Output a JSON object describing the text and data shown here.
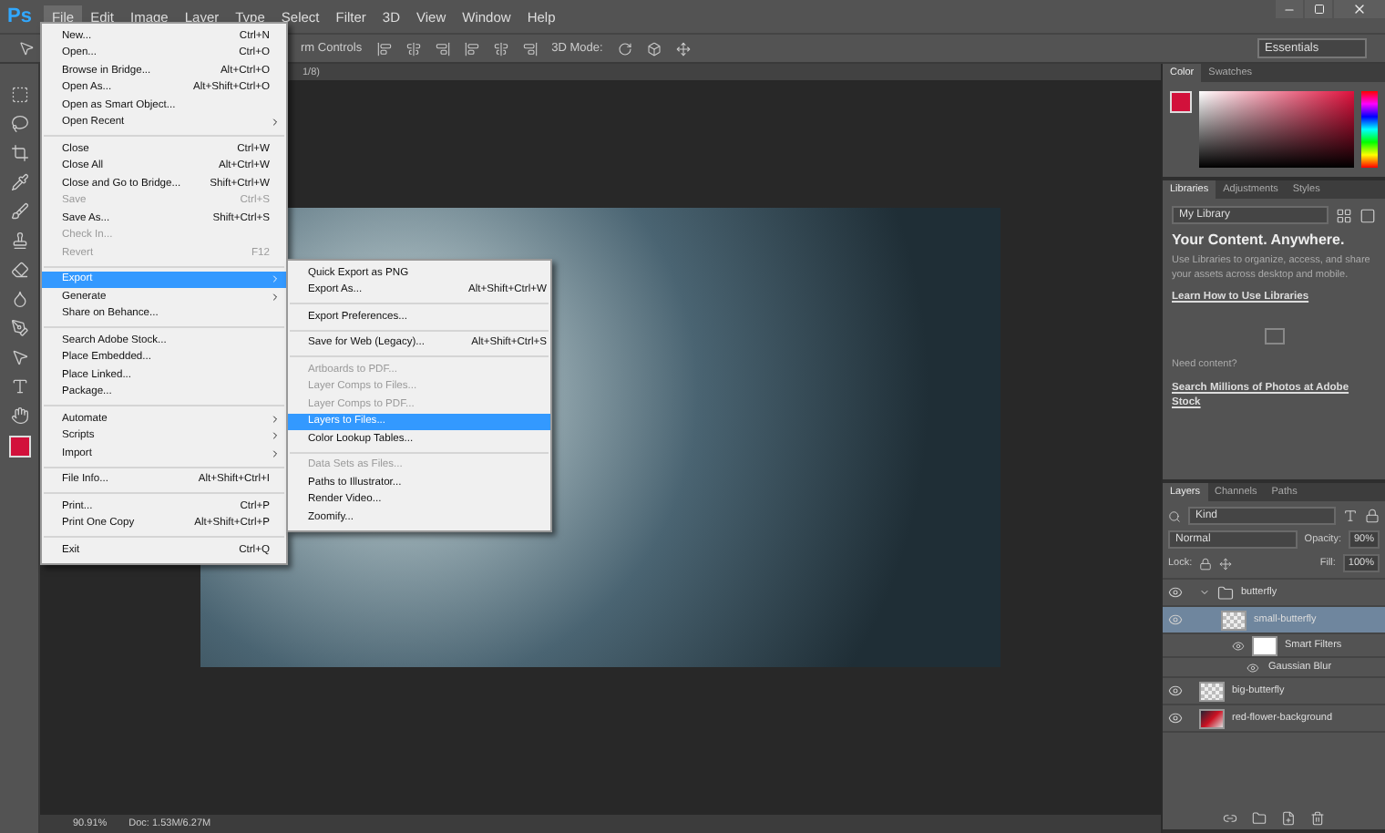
{
  "app_logo": "Ps",
  "menubar": [
    {
      "label": "File",
      "selected": true
    },
    {
      "label": "Edit",
      "selected": false
    },
    {
      "label": "Image",
      "selected": false
    },
    {
      "label": "Layer",
      "selected": false
    },
    {
      "label": "Type",
      "selected": false
    },
    {
      "label": "Select",
      "selected": false
    },
    {
      "label": "Filter",
      "selected": false
    },
    {
      "label": "3D",
      "selected": false
    },
    {
      "label": "View",
      "selected": false
    },
    {
      "label": "Window",
      "selected": false
    },
    {
      "label": "Help",
      "selected": false
    }
  ],
  "options_bar": {
    "transform_label": "rm Controls",
    "mode_label": "3D Mode:",
    "workspace": "Essentials"
  },
  "doc_tab": {
    "title": "1/8)"
  },
  "file_menu": [
    [
      {
        "label": "New...",
        "shortcut": "Ctrl+N",
        "disabled": false,
        "submenu": false,
        "selected": false
      },
      {
        "label": "Open...",
        "shortcut": "Ctrl+O",
        "disabled": false,
        "submenu": false,
        "selected": false
      },
      {
        "label": "Browse in Bridge...",
        "shortcut": "Alt+Ctrl+O",
        "disabled": false,
        "submenu": false,
        "selected": false
      },
      {
        "label": "Open As...",
        "shortcut": "Alt+Shift+Ctrl+O",
        "disabled": false,
        "submenu": false,
        "selected": false
      },
      {
        "label": "Open as Smart Object...",
        "disabled": false,
        "submenu": false,
        "selected": false
      },
      {
        "label": "Open Recent",
        "disabled": false,
        "submenu": true,
        "selected": false
      }
    ],
    [
      {
        "label": "Close",
        "shortcut": "Ctrl+W",
        "disabled": false,
        "submenu": false,
        "selected": false
      },
      {
        "label": "Close All",
        "shortcut": "Alt+Ctrl+W",
        "disabled": false,
        "submenu": false,
        "selected": false
      },
      {
        "label": "Close and Go to Bridge...",
        "shortcut": "Shift+Ctrl+W",
        "disabled": false,
        "submenu": false,
        "selected": false
      },
      {
        "label": "Save",
        "shortcut": "Ctrl+S",
        "disabled": true,
        "submenu": false,
        "selected": false
      },
      {
        "label": "Save As...",
        "shortcut": "Shift+Ctrl+S",
        "disabled": false,
        "submenu": false,
        "selected": false
      },
      {
        "label": "Check In...",
        "disabled": true,
        "submenu": false,
        "selected": false
      },
      {
        "label": "Revert",
        "shortcut": "F12",
        "disabled": true,
        "submenu": false,
        "selected": false
      }
    ],
    [
      {
        "label": "Export",
        "disabled": false,
        "submenu": true,
        "selected": true
      },
      {
        "label": "Generate",
        "disabled": false,
        "submenu": true,
        "selected": false
      },
      {
        "label": "Share on Behance...",
        "disabled": false,
        "submenu": false,
        "selected": false
      }
    ],
    [
      {
        "label": "Search Adobe Stock...",
        "disabled": false,
        "submenu": false,
        "selected": false
      },
      {
        "label": "Place Embedded...",
        "disabled": false,
        "submenu": false,
        "selected": false
      },
      {
        "label": "Place Linked...",
        "disabled": false,
        "submenu": false,
        "selected": false
      },
      {
        "label": "Package...",
        "disabled": false,
        "submenu": false,
        "selected": false
      }
    ],
    [
      {
        "label": "Automate",
        "disabled": false,
        "submenu": true,
        "selected": false
      },
      {
        "label": "Scripts",
        "disabled": false,
        "submenu": true,
        "selected": false
      },
      {
        "label": "Import",
        "disabled": false,
        "submenu": true,
        "selected": false
      }
    ],
    [
      {
        "label": "File Info...",
        "shortcut": "Alt+Shift+Ctrl+I",
        "disabled": false,
        "submenu": false,
        "selected": false
      }
    ],
    [
      {
        "label": "Print...",
        "shortcut": "Ctrl+P",
        "disabled": false,
        "submenu": false,
        "selected": false
      },
      {
        "label": "Print One Copy",
        "shortcut": "Alt+Shift+Ctrl+P",
        "disabled": false,
        "submenu": false,
        "selected": false
      }
    ],
    [
      {
        "label": "Exit",
        "shortcut": "Ctrl+Q",
        "disabled": false,
        "submenu": false,
        "selected": false
      }
    ]
  ],
  "export_menu": [
    [
      {
        "label": "Quick Export as PNG",
        "disabled": false,
        "selected": false
      },
      {
        "label": "Export As...",
        "shortcut": "Alt+Shift+Ctrl+W",
        "disabled": false,
        "selected": false
      }
    ],
    [
      {
        "label": "Export Preferences...",
        "disabled": false,
        "selected": false
      }
    ],
    [
      {
        "label": "Save for Web (Legacy)...",
        "shortcut": "Alt+Shift+Ctrl+S",
        "disabled": false,
        "selected": false
      }
    ],
    [
      {
        "label": "Artboards to PDF...",
        "disabled": true,
        "selected": false
      },
      {
        "label": "Layer Comps to Files...",
        "disabled": true,
        "selected": false
      },
      {
        "label": "Layer Comps to PDF...",
        "disabled": true,
        "selected": false
      },
      {
        "label": "Layers to Files...",
        "disabled": false,
        "selected": true
      },
      {
        "label": "Color Lookup Tables...",
        "disabled": false,
        "selected": false
      }
    ],
    [
      {
        "label": "Data Sets as Files...",
        "disabled": true,
        "selected": false
      },
      {
        "label": "Paths to Illustrator...",
        "disabled": false,
        "selected": false
      },
      {
        "label": "Render Video...",
        "disabled": false,
        "selected": false
      },
      {
        "label": "Zoomify...",
        "disabled": false,
        "selected": false
      }
    ]
  ],
  "color_panel": {
    "tabs": [
      {
        "label": "Color",
        "selected": true
      },
      {
        "label": "Swatches",
        "selected": false
      }
    ]
  },
  "libraries_panel": {
    "tabs": [
      {
        "label": "Libraries",
        "selected": true
      },
      {
        "label": "Adjustments",
        "selected": false
      },
      {
        "label": "Styles",
        "selected": false
      }
    ],
    "library": "My Library",
    "heading": "Your Content. Anywhere.",
    "body": "Use Libraries to organize, access, and share your assets across desktop and mobile.",
    "learn_link": "Learn How to Use Libraries",
    "stock_prompt": "Need content?",
    "stock_link": "Search Millions of Photos at Adobe Stock"
  },
  "layers_panel": {
    "tabs": [
      {
        "label": "Layers",
        "selected": true
      },
      {
        "label": "Channels",
        "selected": false
      },
      {
        "label": "Paths",
        "selected": false
      }
    ],
    "filter": "Kind",
    "blend_mode": "Normal",
    "opacity_label": "Opacity:",
    "opacity": "90%",
    "lock_label": "Lock:",
    "fill_label": "Fill:",
    "fill": "100%",
    "layers": [
      {
        "name": "butterfly",
        "kind": "group",
        "visible": true,
        "expanded": true,
        "selected": false,
        "children": [
          {
            "name": "small-butterfly",
            "kind": "smart",
            "visible": true,
            "selected": true,
            "filters_label": "Smart Filters",
            "filters": [
              {
                "name": "Gaussian Blur",
                "visible": true
              }
            ]
          }
        ]
      },
      {
        "name": "big-butterfly",
        "kind": "smart",
        "visible": true,
        "selected": false
      },
      {
        "name": "red-flower-background",
        "kind": "image",
        "visible": true,
        "selected": false
      }
    ]
  },
  "status_bar": {
    "zoom": "90.91%",
    "doc": "Doc: 1.53M/6.27M"
  }
}
